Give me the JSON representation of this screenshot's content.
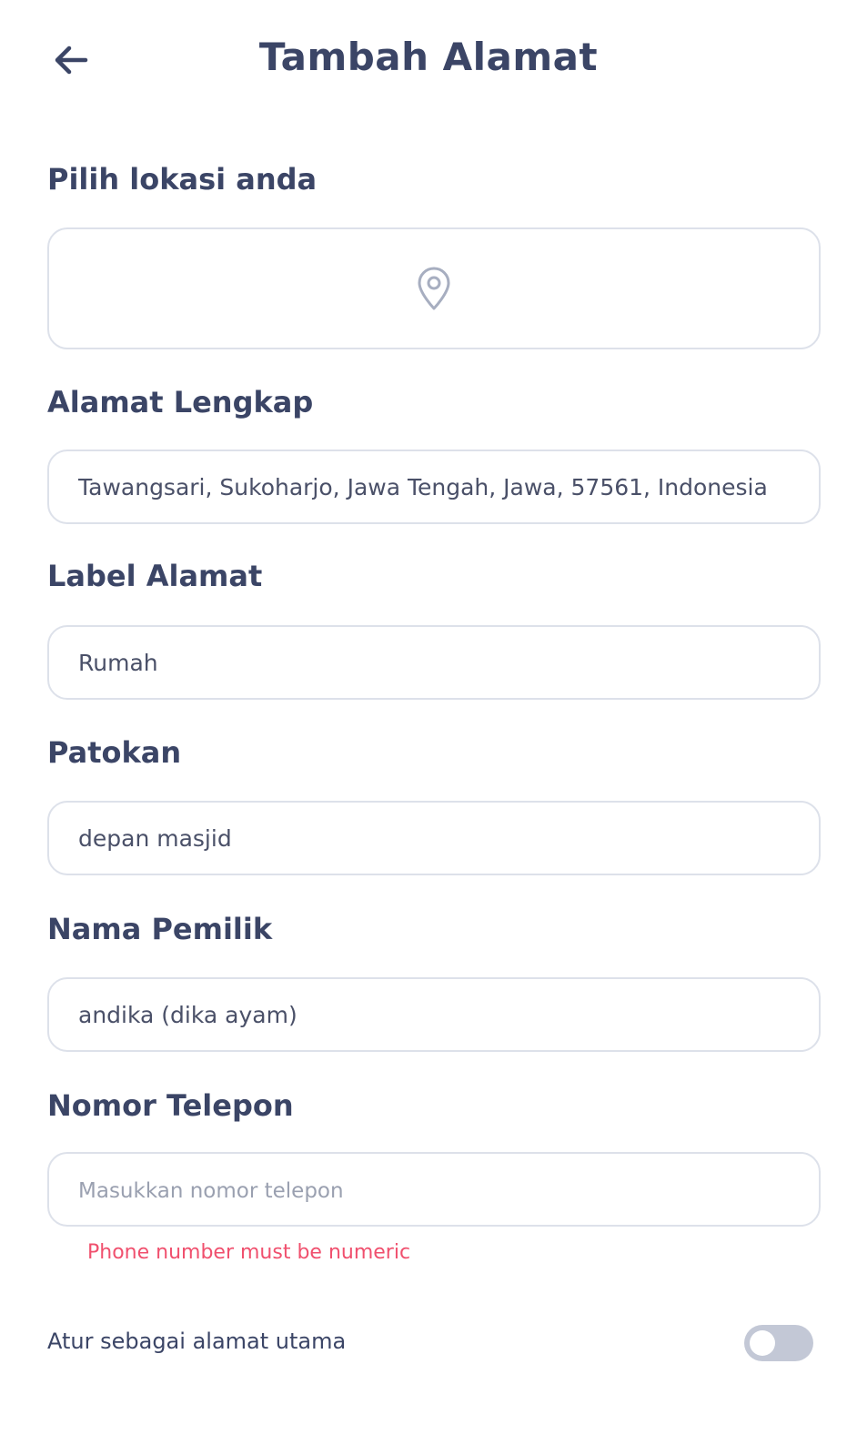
{
  "header": {
    "title": "Tambah Alamat",
    "back_icon": "arrow-left-icon"
  },
  "location": {
    "label": "Pilih lokasi anda",
    "icon": "map-pin-icon"
  },
  "full_address": {
    "label": "Alamat Lengkap",
    "value": "Tawangsari, Sukoharjo, Jawa Tengah, Jawa, 57561, Indonesia"
  },
  "address_label": {
    "label": "Label Alamat",
    "value": "Rumah"
  },
  "landmark": {
    "label": "Patokan",
    "value": "depan masjid"
  },
  "owner_name": {
    "label": "Nama Pemilik",
    "value": "andika (dika ayam)"
  },
  "phone": {
    "label": "Nomor Telepon",
    "value": "",
    "placeholder": "Masukkan nomor telepon",
    "error": "Phone number must be numeric"
  },
  "set_main": {
    "label": "Atur sebagai alamat utama",
    "enabled": false
  },
  "colors": {
    "text": "#3b4566",
    "border": "#dde1ea",
    "error": "#f0506e",
    "toggle_off": "#c3c8d6"
  }
}
